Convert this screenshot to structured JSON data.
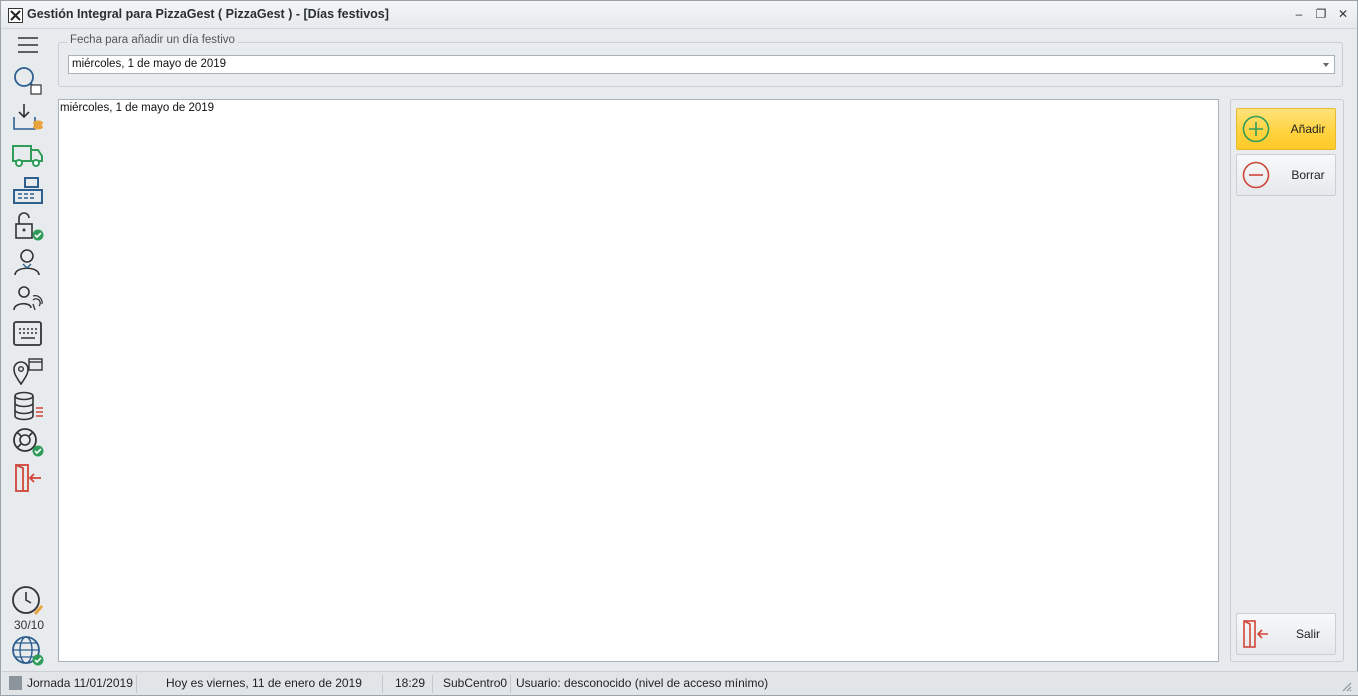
{
  "window": {
    "title": "Gestión Integral para PizzaGest ( PizzaGest ) - [Días festivos]",
    "controls": {
      "minimize": "–",
      "restore": "❐",
      "close": "✕"
    }
  },
  "sidebar": {
    "items": [
      {
        "icon": "hamburger-menu-icon"
      },
      {
        "icon": "search-document-icon"
      },
      {
        "icon": "inbox-coins-icon"
      },
      {
        "icon": "delivery-truck-icon"
      },
      {
        "icon": "cash-register-icon"
      },
      {
        "icon": "unlock-check-icon"
      },
      {
        "icon": "user-icon"
      },
      {
        "icon": "fingerprint-user-icon"
      },
      {
        "icon": "keyboard-screen-icon"
      },
      {
        "icon": "location-store-icon"
      },
      {
        "icon": "database-list-icon"
      },
      {
        "icon": "lifebuoy-check-icon"
      },
      {
        "icon": "exit-door-icon"
      }
    ],
    "bottom": {
      "clock_label": "30/10",
      "icons": [
        "clock-edit-icon",
        "globe-check-icon"
      ]
    }
  },
  "form": {
    "group_label": "Fecha para añadir un día festivo",
    "date_value": "miércoles, 1 de mayo de 2019"
  },
  "list": {
    "items": [
      "miércoles, 1 de mayo de 2019"
    ]
  },
  "actions": {
    "add_label": "Añadir",
    "delete_label": "Borrar",
    "exit_label": "Salir"
  },
  "status": {
    "jornada": "Jornada 11/01/2019",
    "today": "Hoy es viernes, 11 de enero de 2019",
    "time": "18:29",
    "subcentro": "SubCentro0",
    "user": "Usuario: desconocido (nivel de acceso mínimo)"
  },
  "colors": {
    "accent_blue": "#2e5f8f",
    "accent_green": "#2f9c5a",
    "accent_red": "#d0463a",
    "accent_orange": "#e8a33a",
    "hover_yellow": "#ffd23d"
  }
}
